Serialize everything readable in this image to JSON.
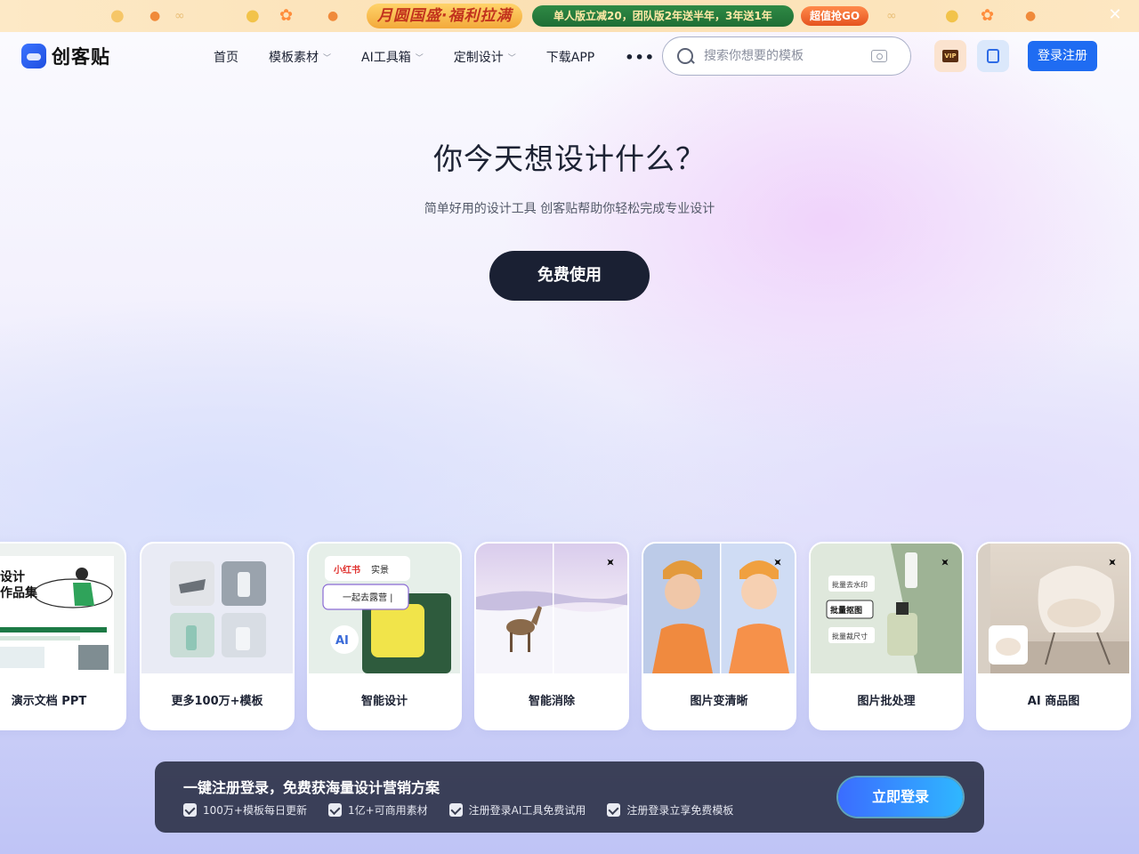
{
  "promo": {
    "title": "月圆国盛·福利拉满",
    "offer": "单人版立减20，团队版2年送半年，3年送1年",
    "go_label": "超值抢GO"
  },
  "header": {
    "logo_text": "创客贴",
    "nav": [
      {
        "label": "首页",
        "has_dropdown": false
      },
      {
        "label": "模板素材",
        "has_dropdown": true
      },
      {
        "label": "AI工具箱",
        "has_dropdown": true
      },
      {
        "label": "定制设计",
        "has_dropdown": true
      },
      {
        "label": "下载APP",
        "has_dropdown": false
      }
    ],
    "more_label": "•••",
    "search_placeholder": "搜索你想要的模板",
    "vip_badge": "VIP",
    "login_label": "登录注册"
  },
  "hero": {
    "title": "你今天想设计什么？",
    "subtitle": "简单好用的设计工具 创客贴帮助你轻松完成专业设计",
    "cta_label": "免费使用"
  },
  "cards": [
    {
      "label": "演示文档 PPT"
    },
    {
      "label": "更多100万+模板"
    },
    {
      "label": "智能设计"
    },
    {
      "label": "智能消除"
    },
    {
      "label": "图片变清晰"
    },
    {
      "label": "图片批处理"
    },
    {
      "label": "AI 商品图"
    }
  ],
  "card_art": {
    "ppt_heading_1": "设计",
    "ppt_heading_2": "作品集",
    "xhs_tag": "小红书",
    "xhs_tag_2": "实景",
    "xhs_input": "一起去露营 |",
    "ai_chip": "AI",
    "batch_items": [
      "批量去水印",
      "批量抠图",
      "批量裁尺寸"
    ]
  },
  "loginbar": {
    "title": "一键注册登录，免费获海量设计营销方案",
    "perks": [
      "100万+模板每日更新",
      "1亿+可商用素材",
      "注册登录AI工具免费试用",
      "注册登录立享免费模板"
    ],
    "button_label": "立即登录"
  },
  "colors": {
    "primary_blue": "#1f6cf2",
    "cta_dark": "#1a2033",
    "promo_bg": "#fbe0b3"
  }
}
